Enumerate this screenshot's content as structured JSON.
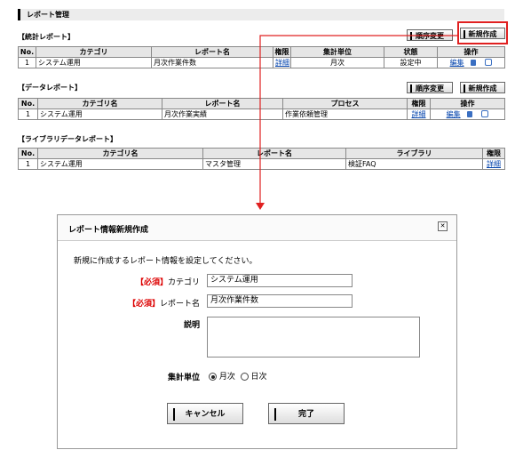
{
  "page": {
    "title": "レポート管理"
  },
  "stats": {
    "title": "【統計レポート】",
    "reorder_label": "順序変更",
    "new_label": "新規作成",
    "headers": [
      "No.",
      "カテゴリ",
      "レポート名",
      "権限",
      "集計単位",
      "状態",
      "操作"
    ],
    "rows": [
      {
        "no": "1",
        "category": "システム運用",
        "name": "月次作業件数",
        "perm": "詳細",
        "unit": "月次",
        "status": "設定中",
        "edit": "編集"
      }
    ]
  },
  "data_report": {
    "title": "【データレポート】",
    "reorder_label": "順序変更",
    "new_label": "新規作成",
    "headers": [
      "No.",
      "カテゴリ名",
      "レポート名",
      "プロセス",
      "権限",
      "操作"
    ],
    "rows": [
      {
        "no": "1",
        "category": "システム運用",
        "name": "月次作業実績",
        "process": "作業依頼管理",
        "perm": "詳細",
        "edit": "編集"
      }
    ]
  },
  "library": {
    "title": "【ライブラリデータレポート】",
    "headers": [
      "No.",
      "カテゴリ名",
      "レポート名",
      "ライブラリ",
      "権限"
    ],
    "rows": [
      {
        "no": "1",
        "category": "システム運用",
        "name": "マスタ管理",
        "library": "検証FAQ",
        "perm": "詳細"
      }
    ]
  },
  "dialog": {
    "title": "レポート情報新規作成",
    "close_icon": "close-icon",
    "intro": "新規に作成するレポート情報を設定してください。",
    "required_tag": "【必須】",
    "category_label": "カテゴリ",
    "category_value": "システム運用",
    "name_label": "レポート名",
    "name_value": "月次作業件数",
    "desc_label": "説明",
    "unit_label": "集計単位",
    "unit_options": [
      {
        "label": "月次",
        "selected": true
      },
      {
        "label": "日次",
        "selected": false
      }
    ],
    "cancel_label": "キャンセル",
    "done_label": "完了"
  },
  "colors": {
    "highlight": "#e02020",
    "link": "#0645ad"
  }
}
